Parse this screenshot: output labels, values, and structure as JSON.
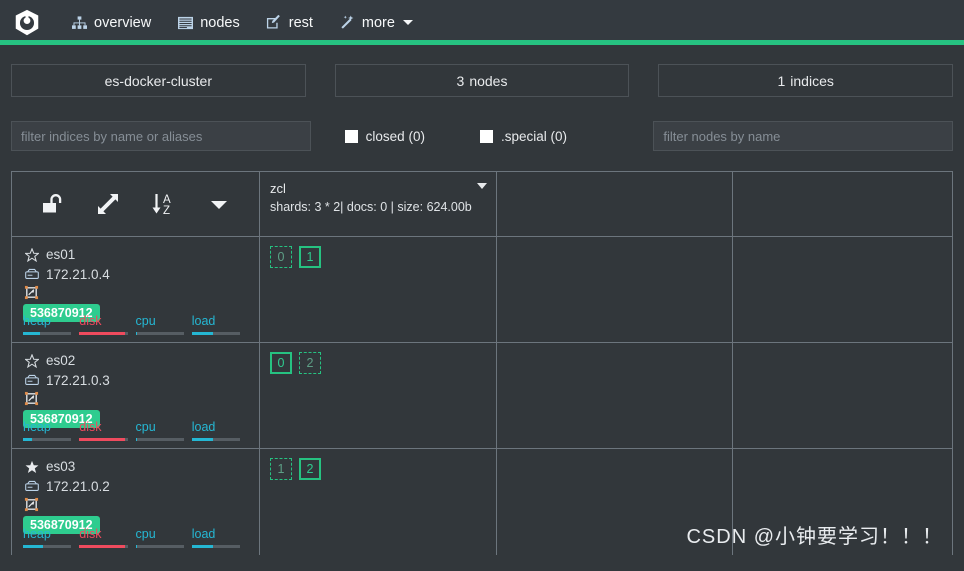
{
  "navbar": {
    "brand_icon": "cerebro-logo",
    "accent_color": "#26c281",
    "items": [
      {
        "label": "overview",
        "icon": "sitemap-icon"
      },
      {
        "label": "nodes",
        "icon": "list-icon"
      },
      {
        "label": "rest",
        "icon": "edit-square-icon"
      },
      {
        "label": "more",
        "icon": "magic-wand-icon",
        "has_caret": true
      }
    ]
  },
  "summary": {
    "cluster_name": "es-docker-cluster",
    "nodes_count": "3",
    "nodes_label": "nodes",
    "indices_count": "1",
    "indices_label": "indices"
  },
  "filters": {
    "indices_placeholder": "filter indices by name or aliases",
    "nodes_placeholder": "filter nodes by name",
    "indices_value": "",
    "nodes_value": "",
    "closed_label": "closed (0)",
    "special_label": ".special (0)",
    "closed_checked": false,
    "special_checked": false
  },
  "toolbar": {
    "lock_icon": "unlock-icon",
    "expand_icon": "expand-arrows-icon",
    "sort_icon": "sort-alpha-down-icon",
    "menu_icon": "chevron-down-icon"
  },
  "indices": [
    {
      "name": "zcl",
      "meta": "shards: 3 * 2| docs: 0 | size: 624.00b",
      "caret_icon": "caret-down-icon"
    }
  ],
  "nodes": [
    {
      "name": "es01",
      "ip": "172.21.0.4",
      "master": false,
      "star_icon": "star-outline-icon",
      "host_icon": "server-icon",
      "data_icon": "data-node-icon",
      "memory": "536870912",
      "bars": [
        {
          "label": "heap",
          "color": "#25b7d3",
          "percent": 35
        },
        {
          "label": "disk",
          "color": "#ef4b5e",
          "percent": 95
        },
        {
          "label": "cpu",
          "color": "#25b7d3",
          "percent": 4
        },
        {
          "label": "load",
          "color": "#25b7d3",
          "percent": 45
        }
      ],
      "shards": [
        {
          "num": "0",
          "state": "replica"
        },
        {
          "num": "1",
          "state": "started"
        }
      ]
    },
    {
      "name": "es02",
      "ip": "172.21.0.3",
      "master": false,
      "star_icon": "star-outline-icon",
      "host_icon": "server-icon",
      "data_icon": "data-node-icon",
      "memory": "536870912",
      "bars": [
        {
          "label": "heap",
          "color": "#25b7d3",
          "percent": 18
        },
        {
          "label": "disk",
          "color": "#ef4b5e",
          "percent": 95
        },
        {
          "label": "cpu",
          "color": "#25b7d3",
          "percent": 4
        },
        {
          "label": "load",
          "color": "#25b7d3",
          "percent": 45
        }
      ],
      "shards": [
        {
          "num": "0",
          "state": "started"
        },
        {
          "num": "2",
          "state": "replica"
        }
      ]
    },
    {
      "name": "es03",
      "ip": "172.21.0.2",
      "master": true,
      "star_icon": "star-filled-icon",
      "host_icon": "server-icon",
      "data_icon": "data-node-icon",
      "memory": "536870912",
      "bars": [
        {
          "label": "heap",
          "color": "#25b7d3",
          "percent": 42
        },
        {
          "label": "disk",
          "color": "#ef4b5e",
          "percent": 95
        },
        {
          "label": "cpu",
          "color": "#25b7d3",
          "percent": 4
        },
        {
          "label": "load",
          "color": "#25b7d3",
          "percent": 45
        }
      ],
      "shards": [
        {
          "num": "1",
          "state": "replica"
        },
        {
          "num": "2",
          "state": "started"
        }
      ]
    }
  ],
  "watermark": "CSDN @小钟要学习！！！"
}
